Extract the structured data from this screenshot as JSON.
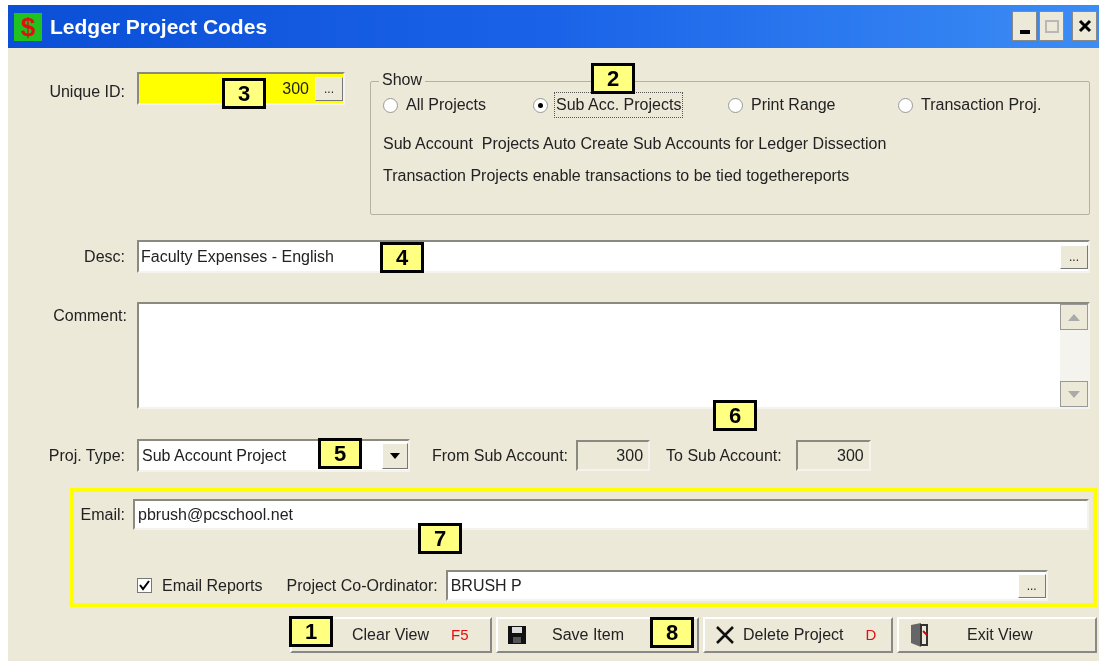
{
  "window": {
    "title": "Ledger Project Codes",
    "icon_glyph": "$",
    "maximize_disabled": true
  },
  "unique_id": {
    "label": "Unique ID:",
    "value": "300",
    "button": "..."
  },
  "show": {
    "legend": "Show",
    "options": [
      {
        "label": "All Projects",
        "selected": false
      },
      {
        "label": "Sub Acc. Projects",
        "selected": true
      },
      {
        "label": "Print Range",
        "selected": false
      },
      {
        "label": "Transaction Proj.",
        "selected": false
      }
    ],
    "notes": [
      "Sub Account  Projects Auto Create Sub Accounts for Ledger Dissection",
      "Transaction Projects enable transactions to be tied togethereports"
    ]
  },
  "desc": {
    "label": "Desc:",
    "value": "Faculty Expenses - English",
    "button": "..."
  },
  "comment": {
    "label": "Comment:"
  },
  "proj_type": {
    "label": "Proj. Type:",
    "value": "Sub Account Project",
    "from_label": "From Sub Account:",
    "from_value": "300",
    "to_label": "To Sub Account:",
    "to_value": "300"
  },
  "email": {
    "label": "Email:",
    "value": "pbrush@pcschool.net",
    "reports_label": "Email Reports",
    "reports_checked": true,
    "coordinator_label": "Project Co-Ordinator:",
    "coordinator_value": "BRUSH P",
    "button": "..."
  },
  "buttons": [
    {
      "kind": "clear",
      "label": "Clear View",
      "shortcut": "F5"
    },
    {
      "kind": "save",
      "label": "Save Item"
    },
    {
      "kind": "delete",
      "label": "Delete Project",
      "shortcut": "D"
    },
    {
      "kind": "exit",
      "label": "Exit View"
    }
  ],
  "callouts": [
    {
      "number": "3"
    },
    {
      "number": "2"
    },
    {
      "number": "4"
    },
    {
      "number": "5"
    },
    {
      "number": "6"
    },
    {
      "number": "7"
    },
    {
      "number": "1"
    },
    {
      "number": "8"
    }
  ]
}
